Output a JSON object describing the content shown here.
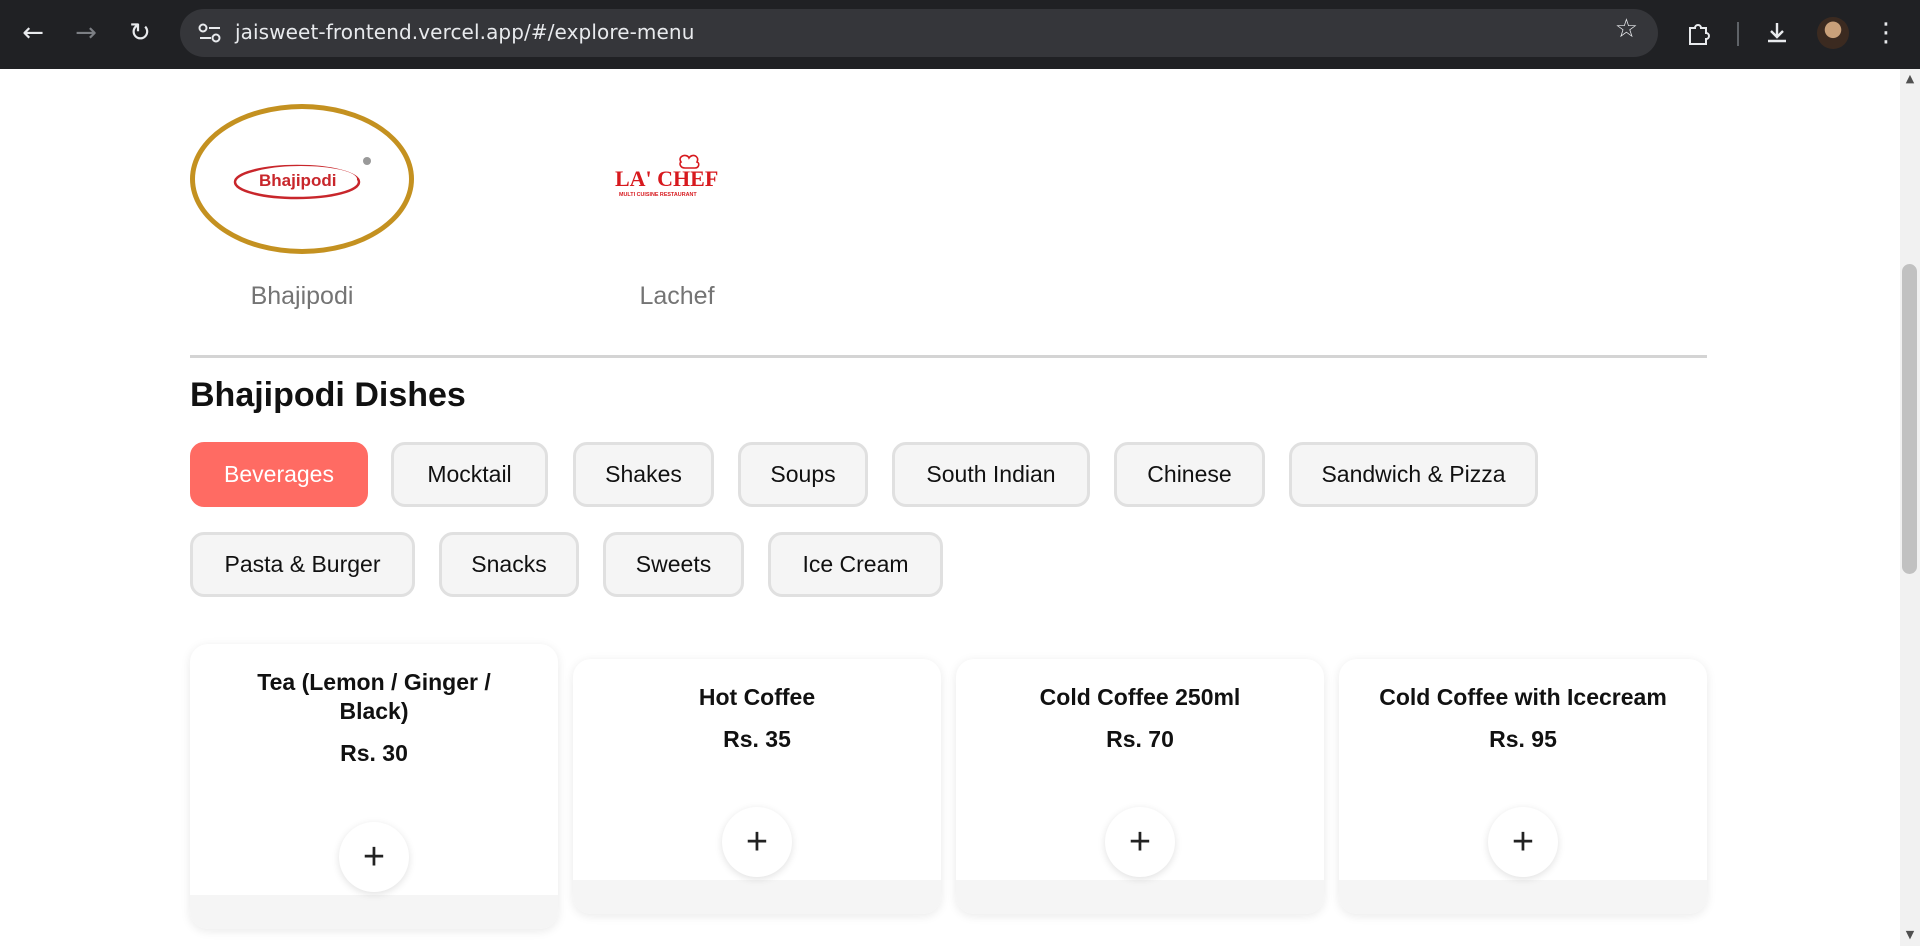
{
  "browser": {
    "url": "jaisweet-frontend.vercel.app/#/explore-menu"
  },
  "restaurants": [
    {
      "name": "Bhajipodi",
      "logo_text": "Bhajipodi",
      "selected": true
    },
    {
      "name": "Lachef",
      "logo_text": "LA' CHEF",
      "logo_subtext": "MULTI CUISINE RESTAURANT",
      "selected": false
    }
  ],
  "section_title": "Bhajipodi Dishes",
  "categories": [
    {
      "label": "Beverages",
      "active": true
    },
    {
      "label": "Mocktail"
    },
    {
      "label": "Shakes"
    },
    {
      "label": "Soups"
    },
    {
      "label": "South Indian"
    },
    {
      "label": "Chinese"
    },
    {
      "label": "Sandwich & Pizza"
    },
    {
      "label": "Pasta & Burger"
    },
    {
      "label": "Snacks"
    },
    {
      "label": "Sweets"
    },
    {
      "label": "Ice Cream"
    }
  ],
  "dishes": [
    {
      "name": "Tea (Lemon / Ginger / Black)",
      "price": "Rs. 30"
    },
    {
      "name": "Hot Coffee",
      "price": "Rs. 35"
    },
    {
      "name": "Cold Coffee 250ml",
      "price": "Rs. 70"
    },
    {
      "name": "Cold Coffee with Icecream",
      "price": "Rs. 95"
    }
  ],
  "add_symbol": "+",
  "colors": {
    "accent": "#ff6b63",
    "selected_ring": "#c49120",
    "brand_red": "#d7191e"
  }
}
